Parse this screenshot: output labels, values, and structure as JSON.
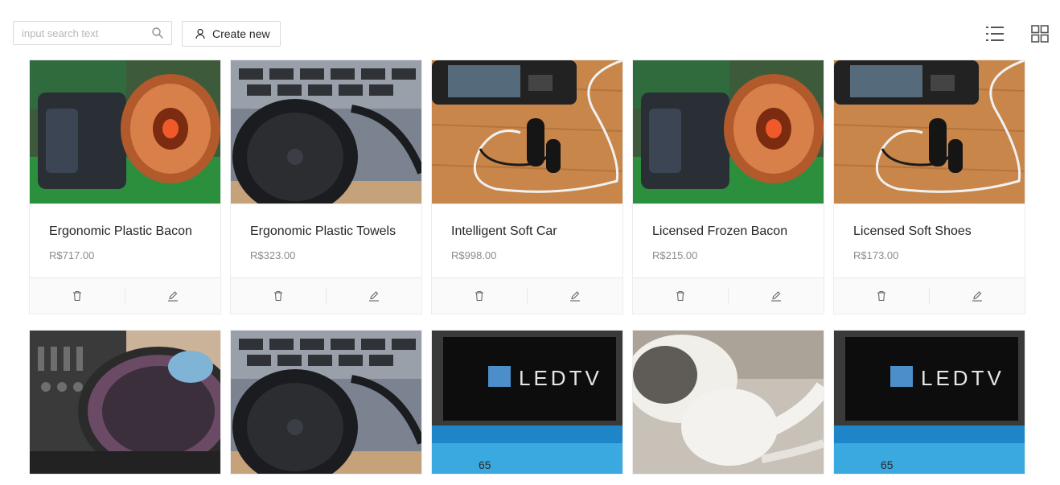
{
  "toolbar": {
    "search_placeholder": "input search text",
    "search_icon": "search-icon",
    "create_label": "Create new",
    "create_icon": "user-icon",
    "list_view_icon": "list-view-icon",
    "grid_view_icon": "grid-view-icon"
  },
  "products": [
    {
      "name": "Ergonomic Plastic Bacon",
      "price": "R$717.00",
      "image": "copper-coil"
    },
    {
      "name": "Ergonomic Plastic Towels",
      "price": "R$323.00",
      "image": "headphones"
    },
    {
      "name": "Intelligent Soft Car",
      "price": "R$998.00",
      "image": "earphones-phone"
    },
    {
      "name": "Licensed Frozen Bacon",
      "price": "R$215.00",
      "image": "copper-coil"
    },
    {
      "name": "Licensed Soft Shoes",
      "price": "R$173.00",
      "image": "earphones-phone"
    },
    {
      "image": "turntable"
    },
    {
      "image": "headphones"
    },
    {
      "image": "led-tv",
      "image_text": "LEDTV"
    },
    {
      "image": "earbuds"
    },
    {
      "image": "led-tv",
      "image_text": "LEDTV"
    }
  ],
  "actions": {
    "delete_icon": "trash-icon",
    "edit_icon": "pencil-icon"
  },
  "colors": {
    "border": "#d9d9d9",
    "price": "#8c8c8c",
    "action_bar": "#fafafa"
  }
}
